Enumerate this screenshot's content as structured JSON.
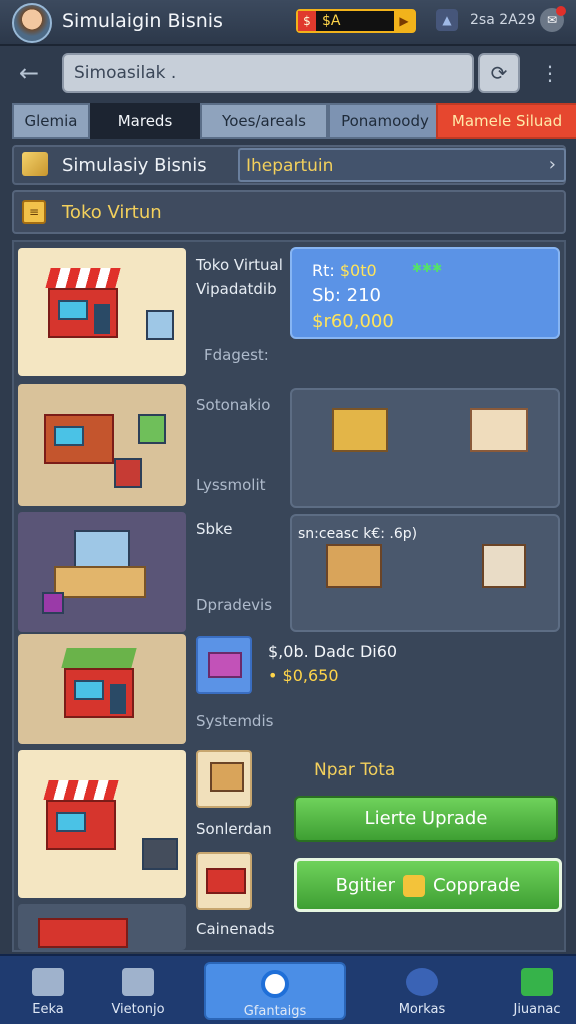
{
  "header": {
    "title": "Simulaigin Bisnis",
    "coins": "$A",
    "coin_icon": "$",
    "time": "2sa 2A29",
    "signal_icon": "signal-icon"
  },
  "search": {
    "value": "Simoasilak .",
    "placeholder": "Simoasilak ."
  },
  "tabs": [
    "Glemia",
    "Mareds",
    "Yoes/areals",
    "Ponamoody",
    "Mamele Siluad"
  ],
  "section": {
    "title": "Simulasiy Bisnis",
    "department": "Ihepartuin"
  },
  "shop": {
    "title": "Toko Virtun"
  },
  "listing": {
    "name": "Toko Virtual",
    "sub": "Vipadatdib",
    "label": "Fdagest:",
    "stats": {
      "r_label": "Rt:",
      "r_value": "$0t0",
      "line2": "Sb: 210",
      "line3": "$r60,000"
    },
    "labels": [
      "Sotonakio",
      "Lyssmolit",
      "Sbke",
      "Dpradevis",
      "Systemdis",
      "Sonlerdan",
      "Cainenads"
    ],
    "panel_text": "sn:ceasc  k€:  .6p)",
    "price_line1": "$,0b. Dadc  Di60",
    "price_line2": "$0,650",
    "price_bullet": "•",
    "near_title": "Npar Tota",
    "upgrade_button": "Lierte Uprade",
    "compare_left": "Bgitier",
    "compare_right": "Copprade"
  },
  "bottom_nav": [
    "Eeka",
    "Vietonjo",
    "Gfantaigs",
    "Morkas",
    "Jiuanac"
  ],
  "colors": {
    "accent_blue": "#5b93e6",
    "accent_red": "#e6472f",
    "accent_green": "#4caf3d",
    "gold": "#f3d05c"
  }
}
